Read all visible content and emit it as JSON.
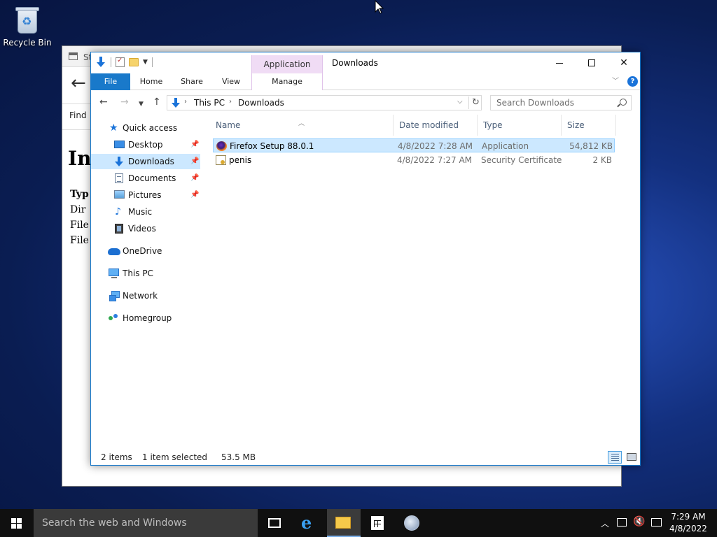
{
  "desktop": {
    "recycle_bin_label": "Recycle Bin"
  },
  "background_window": {
    "tab_text": "St",
    "find_text": "Find",
    "heading": "In",
    "lines": [
      "Typ",
      "Dir",
      "File",
      "File"
    ]
  },
  "explorer": {
    "title": "Downloads",
    "context_tab_group": "Application Tools",
    "ribbon_tabs": {
      "file": "File",
      "home": "Home",
      "share": "Share",
      "view": "View",
      "manage": "Manage"
    },
    "address": {
      "crumbs": [
        "This PC",
        "Downloads"
      ]
    },
    "search": {
      "placeholder": "Search Downloads"
    },
    "nav_pane": {
      "quick_access": "Quick access",
      "pinned": [
        "Desktop",
        "Downloads",
        "Documents",
        "Pictures"
      ],
      "unpinned": [
        "Music",
        "Videos"
      ],
      "onedrive": "OneDrive",
      "this_pc": "This PC",
      "network": "Network",
      "homegroup": "Homegroup"
    },
    "columns": {
      "name": "Name",
      "date": "Date modified",
      "type": "Type",
      "size": "Size"
    },
    "files": [
      {
        "name": "Firefox Setup 88.0.1",
        "date": "4/8/2022 7:28 AM",
        "type": "Application",
        "size": "54,812 KB",
        "icon": "firefox-icon",
        "selected": true
      },
      {
        "name": "penis",
        "date": "4/8/2022 7:27 AM",
        "type": "Security Certificate",
        "size": "2 KB",
        "icon": "certificate-icon",
        "selected": false
      }
    ],
    "status": {
      "count": "2 items",
      "selection": "1 item selected",
      "size": "53.5 MB"
    }
  },
  "taskbar": {
    "search_placeholder": "Search the web and Windows",
    "time": "7:29 AM",
    "date": "4/8/2022"
  },
  "colors": {
    "accent": "#1979ca",
    "selection": "#cce8ff",
    "context_tab": "#f0dcf5"
  }
}
